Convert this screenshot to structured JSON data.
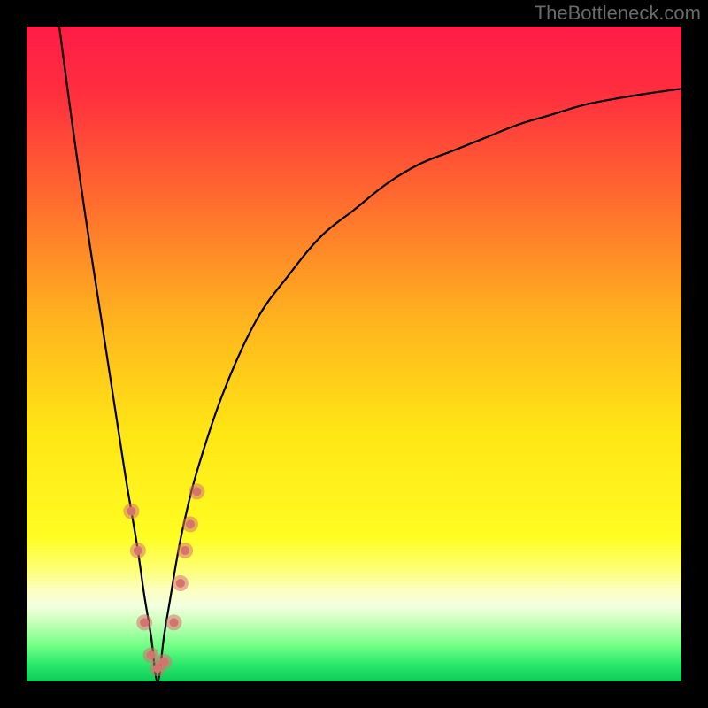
{
  "watermark": "TheBottleneck.com",
  "chart_data": {
    "type": "line",
    "title": "",
    "xlabel": "",
    "ylabel": "",
    "xlim": [
      0,
      100
    ],
    "ylim": [
      0,
      100
    ],
    "grid": false,
    "legend": false,
    "description": "Bottleneck curve: absolute mismatch between two components, plotted over a red-to-green gradient background. Minimum (optimal match) at x≈20.",
    "series": [
      {
        "name": "bottleneck-curve",
        "color": "#000000",
        "x": [
          5,
          7,
          9,
          11,
          13,
          15,
          16,
          17,
          18,
          19,
          20,
          21,
          22,
          23,
          24,
          26,
          30,
          35,
          40,
          45,
          50,
          55,
          60,
          65,
          70,
          75,
          80,
          85,
          90,
          95,
          100
        ],
        "y": [
          100,
          85,
          71,
          58,
          45,
          32,
          26,
          20,
          13,
          7,
          0,
          7,
          13,
          19,
          24,
          32,
          44,
          55,
          62,
          68,
          72,
          76,
          79,
          81,
          83,
          85,
          86.5,
          88,
          89,
          89.8,
          90.5
        ]
      }
    ],
    "markers": {
      "name": "highlighted-points",
      "color": "#d5736f",
      "radius_outer": 9,
      "radius_inner": 5,
      "points": [
        {
          "x": 16,
          "y": 26
        },
        {
          "x": 17,
          "y": 20
        },
        {
          "x": 18.0,
          "y": 9
        },
        {
          "x": 19,
          "y": 4
        },
        {
          "x": 20,
          "y": 2
        },
        {
          "x": 21,
          "y": 3
        },
        {
          "x": 22.5,
          "y": 9
        },
        {
          "x": 23.5,
          "y": 15
        },
        {
          "x": 24.2,
          "y": 20
        },
        {
          "x": 25,
          "y": 24
        },
        {
          "x": 26,
          "y": 29
        }
      ]
    },
    "background_gradient": {
      "stops": [
        {
          "offset": 0.0,
          "color": "#ff1c47"
        },
        {
          "offset": 0.1,
          "color": "#ff2e3f"
        },
        {
          "offset": 0.25,
          "color": "#ff6630"
        },
        {
          "offset": 0.45,
          "color": "#ffb41e"
        },
        {
          "offset": 0.62,
          "color": "#ffe615"
        },
        {
          "offset": 0.78,
          "color": "#fffd22"
        },
        {
          "offset": 0.83,
          "color": "#fdff77"
        },
        {
          "offset": 0.86,
          "color": "#fcffc0"
        },
        {
          "offset": 0.885,
          "color": "#f3ffdf"
        },
        {
          "offset": 0.91,
          "color": "#c6ffb8"
        },
        {
          "offset": 0.945,
          "color": "#73ff87"
        },
        {
          "offset": 0.975,
          "color": "#28e86b"
        },
        {
          "offset": 1.0,
          "color": "#0fca59"
        }
      ]
    }
  }
}
